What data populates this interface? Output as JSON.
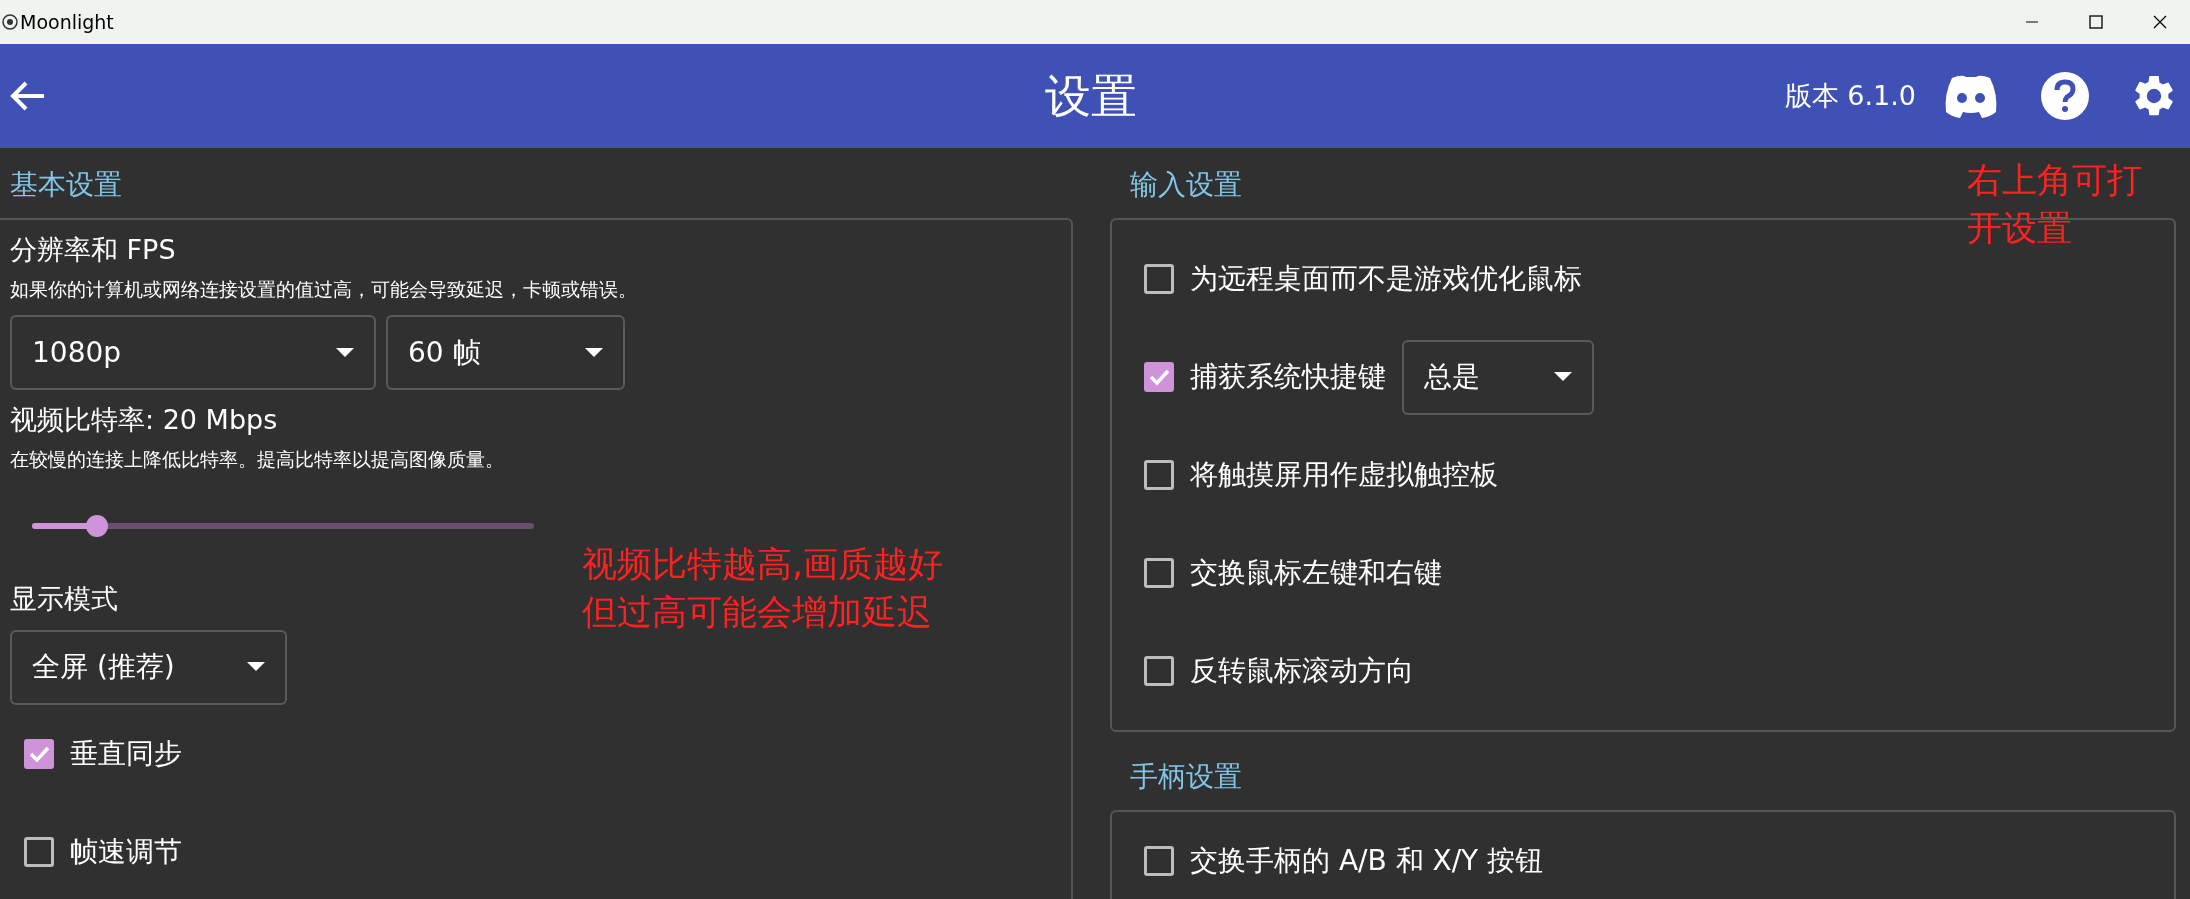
{
  "window": {
    "title": "Moonlight"
  },
  "header": {
    "title": "设置",
    "version": "版本 6.1.0"
  },
  "basic": {
    "heading": "基本设置",
    "resolution": {
      "label": "分辨率和 FPS",
      "hint": "如果你的计算机或网络连接设置的值过高，可能会导致延迟，卡顿或错误。",
      "resolution_value": "1080p",
      "fps_value": "60 帧"
    },
    "bitrate": {
      "label": "视频比特率: 20 Mbps",
      "hint": "在较慢的连接上降低比特率。提高比特率以提高图像质量。",
      "level": 0.13
    },
    "display_mode": {
      "label": "显示模式",
      "value": "全屏 (推荐)"
    },
    "options": [
      {
        "label": "垂直同步",
        "checked": true
      },
      {
        "label": "帧速调节",
        "checked": false
      }
    ]
  },
  "input": {
    "heading": "输入设置",
    "options": [
      {
        "kind": "checkbox",
        "label": "为远程桌面而不是游戏优化鼠标",
        "checked": false
      },
      {
        "kind": "checkbox-select",
        "label": "捕获系统快捷键",
        "checked": true,
        "value": "总是"
      },
      {
        "kind": "checkbox",
        "label": "将触摸屏用作虚拟触控板",
        "checked": false
      },
      {
        "kind": "checkbox",
        "label": "交换鼠标左键和右键",
        "checked": false
      },
      {
        "kind": "checkbox",
        "label": "反转鼠标滚动方向",
        "checked": false
      }
    ]
  },
  "gamepad": {
    "heading": "手柄设置",
    "options": [
      {
        "label": "交换手柄的 A/B 和 X/Y 按钮",
        "checked": false
      }
    ]
  },
  "annotations": [
    {
      "kind": "left",
      "lines": [
        "视频比特越高,画质越好",
        "但过高可能会增加延迟"
      ]
    },
    {
      "kind": "right",
      "lines": [
        "右上角可打",
        "开设置"
      ]
    }
  ]
}
